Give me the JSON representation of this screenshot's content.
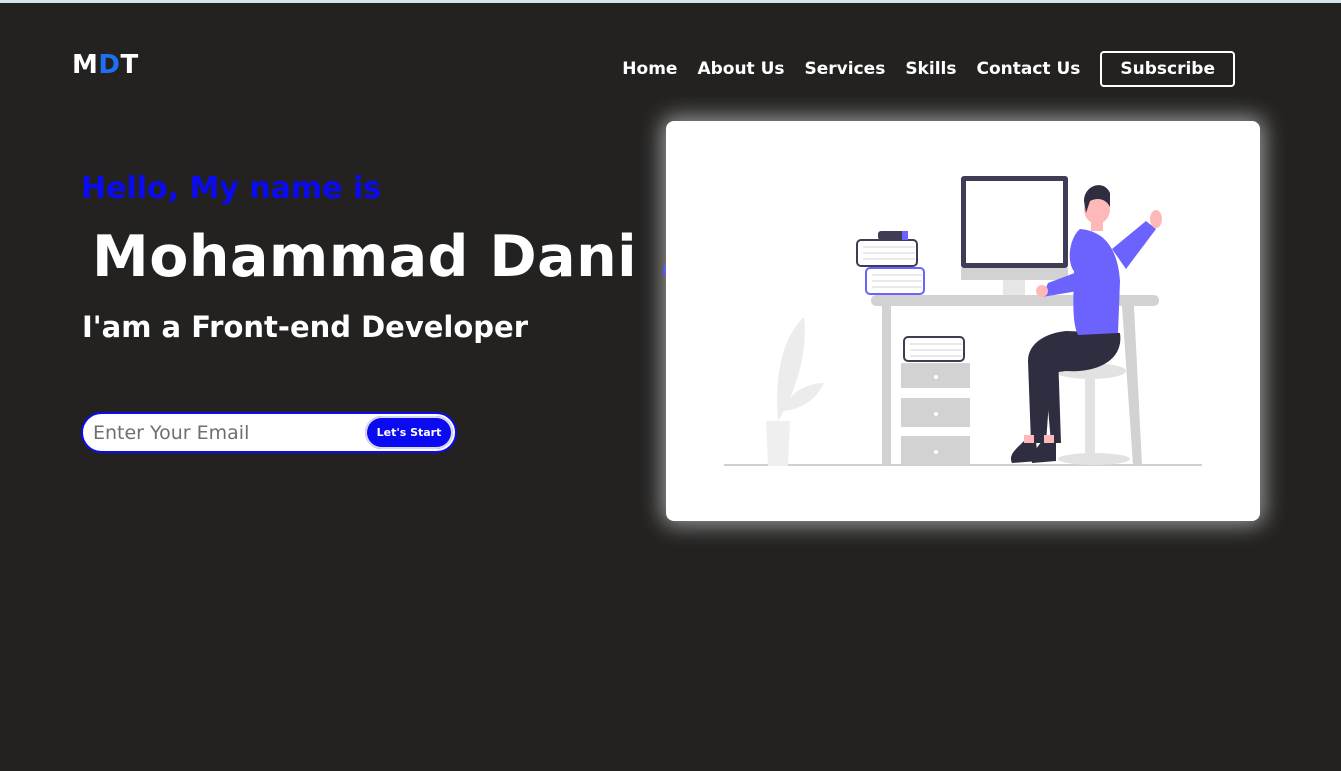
{
  "logo": {
    "part1": "M",
    "part2": "D",
    "part3": "T"
  },
  "nav": {
    "items": [
      "Home",
      "About Us",
      "Services",
      "Skills",
      "Contact Us"
    ],
    "subscribe": "Subscribe"
  },
  "hero": {
    "greeting": "Hello, My name is",
    "name": "Mohammad Dani",
    "name_accent": ".T",
    "role": "I'am a Front-end Developer",
    "email_placeholder": "Enter Your Email",
    "start_button": "Let's Start"
  },
  "colors": {
    "background": "#232221",
    "accent_blue": "#0b0bf2",
    "logo_blue": "#1f6ff2",
    "illustration_purple": "#6c63ff"
  },
  "illustration": {
    "icon": "developer-at-desk-illustration"
  }
}
